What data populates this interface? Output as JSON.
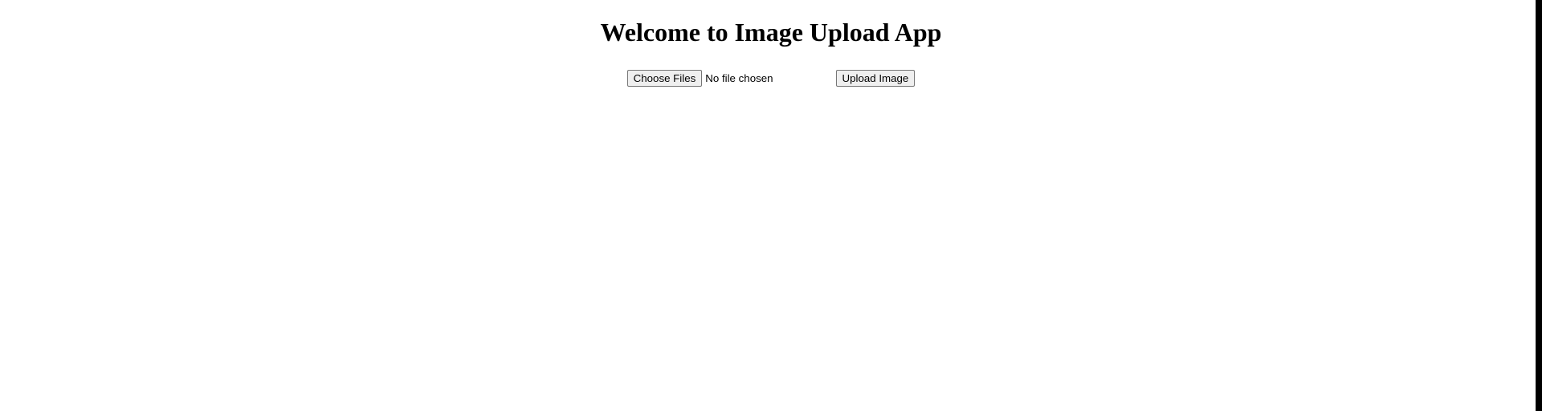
{
  "header": {
    "title": "Welcome to Image Upload App"
  },
  "form": {
    "choose_files_label": "Choose Files",
    "file_status_text": "No file chosen",
    "upload_button_label": "Upload Image"
  }
}
